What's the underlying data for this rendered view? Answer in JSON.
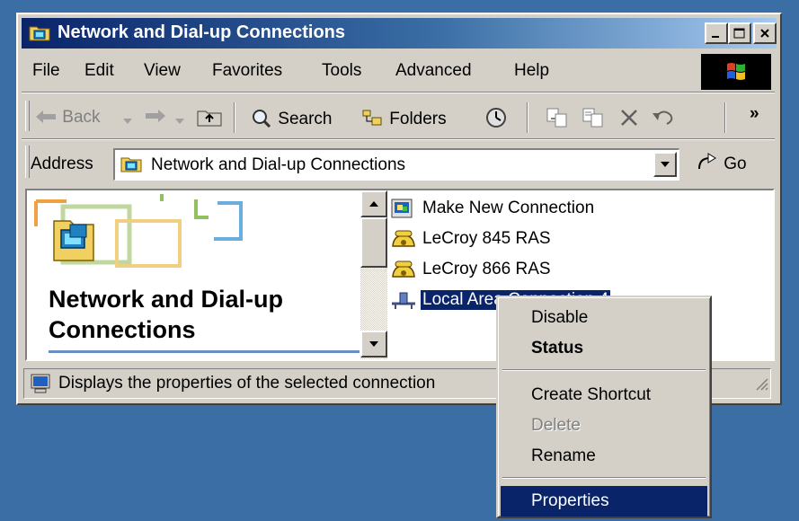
{
  "window": {
    "title": "Network and Dial-up Connections",
    "controls": {
      "minimize": "_",
      "maximize": "□",
      "close": "×"
    }
  },
  "menubar": {
    "items": [
      "File",
      "Edit",
      "View",
      "Favorites",
      "Tools",
      "Advanced",
      "Help"
    ]
  },
  "toolbar": {
    "back_label": "Back",
    "search_label": "Search",
    "folders_label": "Folders",
    "more_label": "»"
  },
  "address": {
    "label": "Address",
    "value": "Network and Dial-up Connections",
    "go_label": "Go"
  },
  "left_pane": {
    "title": "Network and Dial-up Connections"
  },
  "items": [
    {
      "label": "Make New Connection",
      "icon": "make-new-connection-icon"
    },
    {
      "label": "LeCroy 845 RAS",
      "icon": "dialup-phone-icon"
    },
    {
      "label": "LeCroy 866 RAS",
      "icon": "dialup-phone-icon"
    },
    {
      "label": "Local Area Connection 4",
      "icon": "lan-connection-icon",
      "selected": true
    }
  ],
  "status": {
    "text": "Displays the properties of the selected connection"
  },
  "context_menu": {
    "disable": "Disable",
    "status": "Status",
    "create_shortcut": "Create Shortcut",
    "delete": "Delete",
    "rename": "Rename",
    "properties": "Properties"
  },
  "colors": {
    "desktop": "#3a6ea5",
    "face": "#d4d0c8",
    "title_start": "#0a246a",
    "title_end": "#a6caf0",
    "highlight": "#0a246a"
  }
}
